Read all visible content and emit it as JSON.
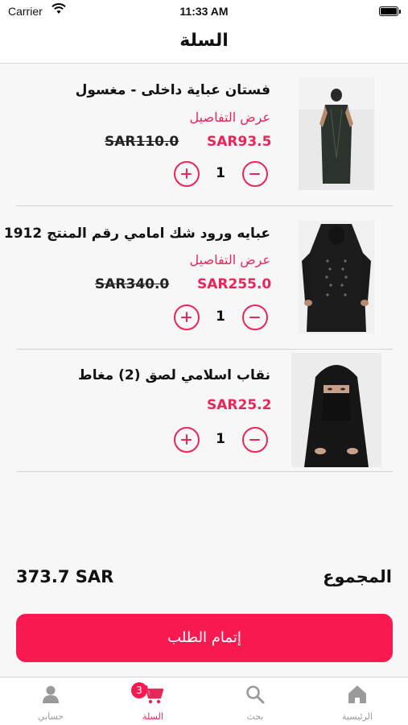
{
  "status_bar": {
    "carrier": "Carrier",
    "time": "11:33 AM"
  },
  "nav": {
    "title": "السلة"
  },
  "cart": {
    "details_label": "عرض التفاصيل",
    "items": [
      {
        "name": "فستان عباية داخلى - مغسول",
        "price": "SAR93.5",
        "old_price": "SAR110.0",
        "quantity": "1"
      },
      {
        "name": "عبايه ورود شك امامي رقم المنتج 1912",
        "price": "SAR255.0",
        "old_price": "SAR340.0",
        "quantity": "1"
      },
      {
        "name": "نقاب اسلامي لصق (2) مغاط",
        "price": "SAR25.2",
        "quantity": "1"
      }
    ]
  },
  "summary": {
    "total_label": "المجموع",
    "total_value": "373.7 SAR"
  },
  "checkout": {
    "label": "إتمام الطلب"
  },
  "tabs": [
    {
      "label": "الرئيسية",
      "icon": "home-icon"
    },
    {
      "label": "بحث",
      "icon": "search-icon"
    },
    {
      "label": "السلة",
      "icon": "cart-icon",
      "badge": "3",
      "active": true
    },
    {
      "label": "حسابي",
      "icon": "person-icon"
    }
  ],
  "colors": {
    "accent": "#e8265a",
    "button": "#f7194f",
    "inactive_tab": "#9a9a9a"
  }
}
